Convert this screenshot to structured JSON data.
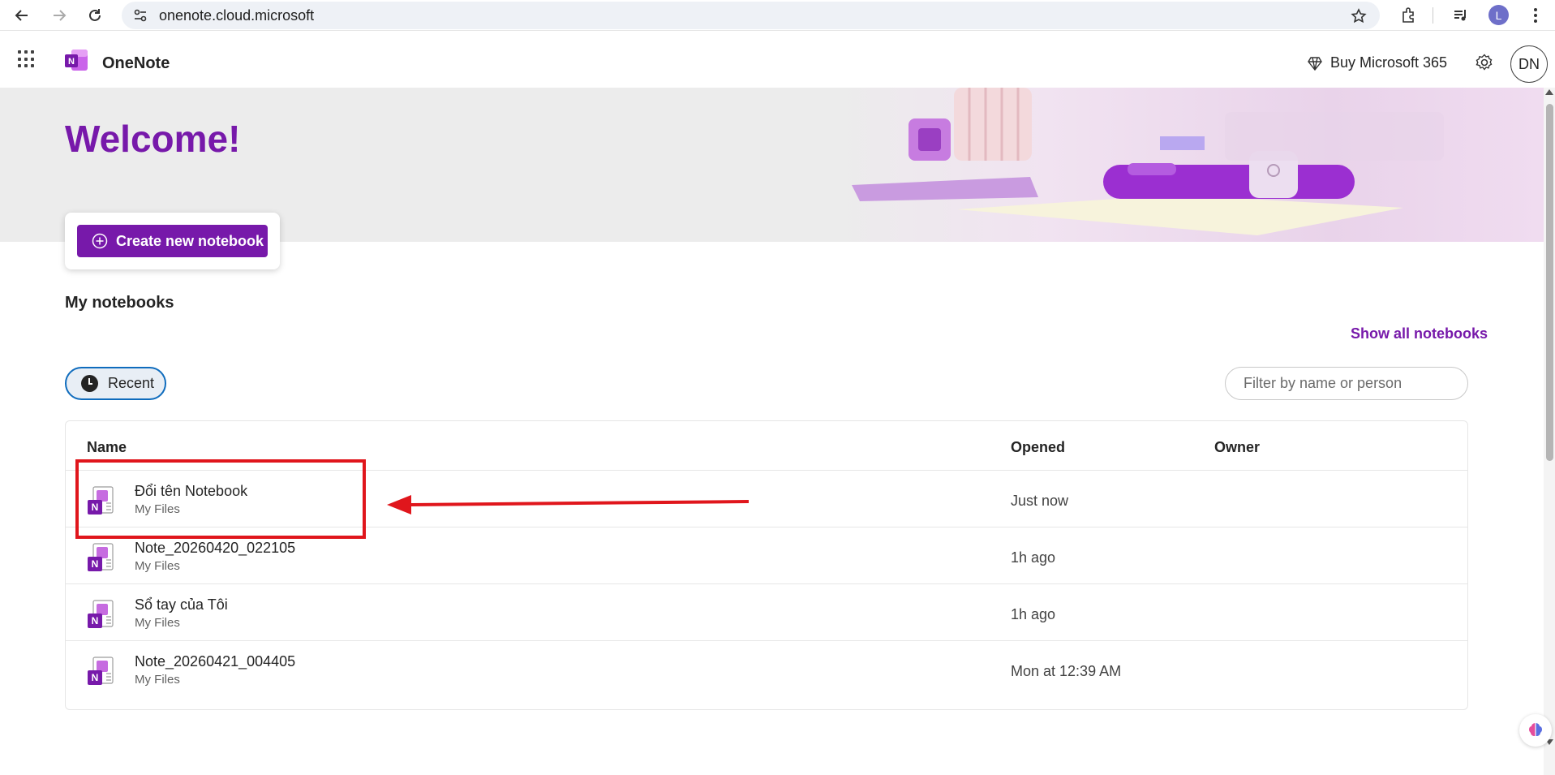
{
  "browser": {
    "url": "onenote.cloud.microsoft",
    "profile_initial": "L"
  },
  "header": {
    "app_name": "OneNote",
    "buy_label": "Buy Microsoft 365",
    "avatar_initials": "DN"
  },
  "hero": {
    "welcome": "Welcome!",
    "create_label": "Create new notebook"
  },
  "notebooks": {
    "section_title": "My notebooks",
    "show_all_label": "Show all notebooks",
    "recent_label": "Recent",
    "filter_placeholder": "Filter by name or person",
    "columns": {
      "name": "Name",
      "opened": "Opened",
      "owner": "Owner"
    },
    "rows": [
      {
        "name": "Đổi tên Notebook",
        "location": "My Files",
        "opened": "Just now",
        "owner": ""
      },
      {
        "name": "Note_20260420_022105",
        "location": "My Files",
        "opened": "1h ago",
        "owner": ""
      },
      {
        "name": "Sổ tay của Tôi",
        "location": "My Files",
        "opened": "1h ago",
        "owner": ""
      },
      {
        "name": "Note_20260421_004405",
        "location": "My Files",
        "opened": "Mon at 12:39 AM",
        "owner": ""
      }
    ]
  },
  "colors": {
    "brand": "#7719aa",
    "annotation": "#e0161c"
  }
}
